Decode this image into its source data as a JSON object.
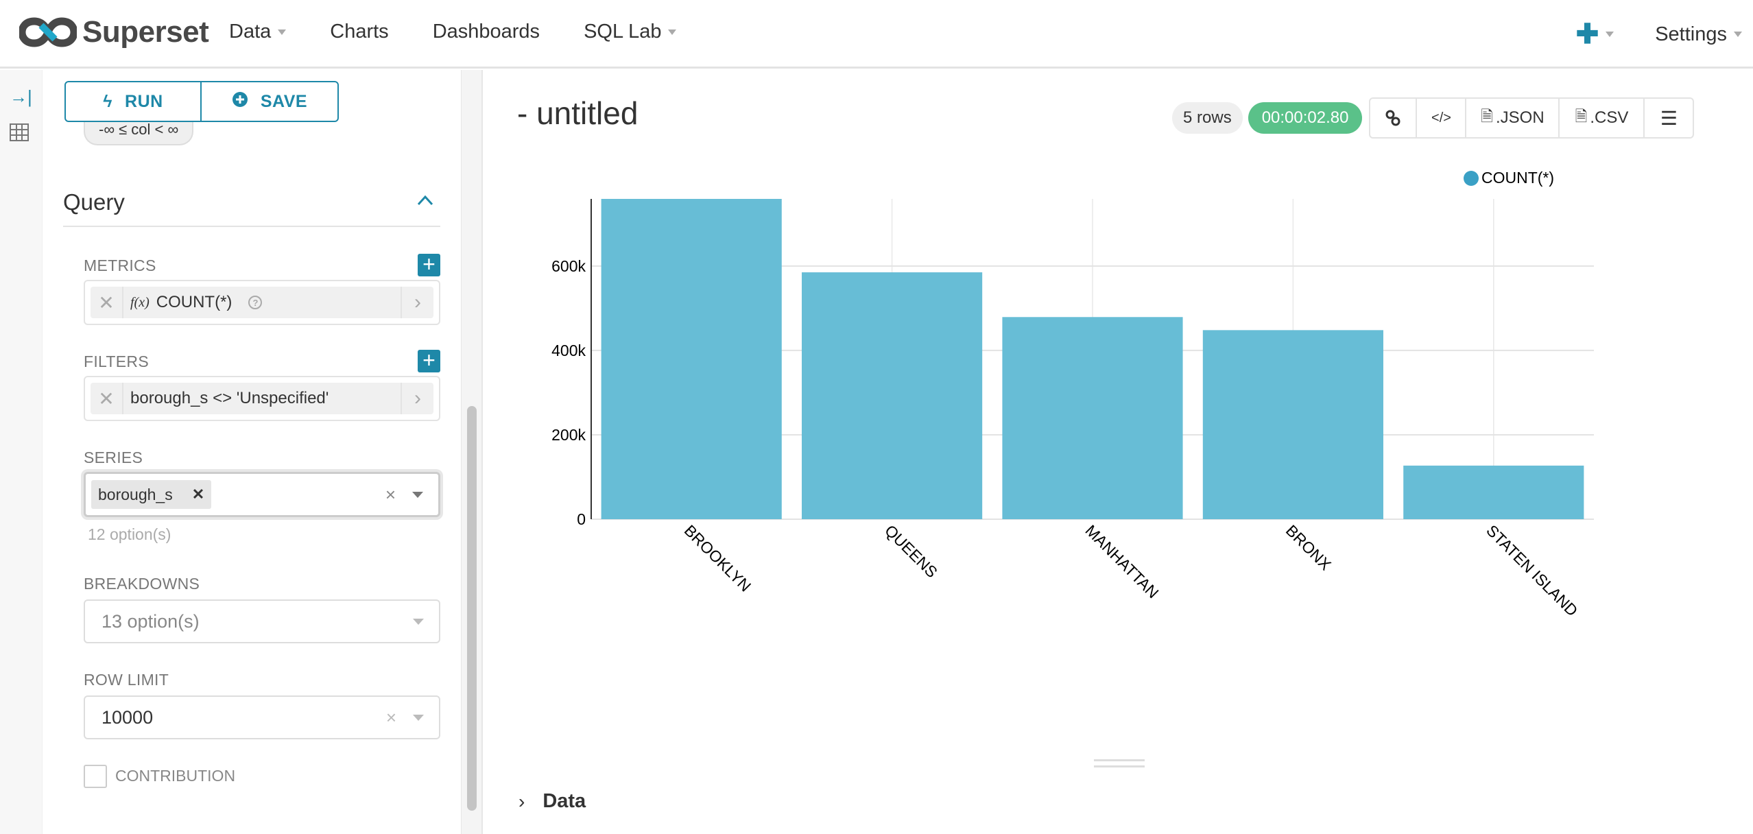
{
  "header": {
    "brand": "Superset",
    "nav": [
      {
        "label": "Data",
        "dropdown": true
      },
      {
        "label": "Charts",
        "dropdown": false
      },
      {
        "label": "Dashboards",
        "dropdown": false
      },
      {
        "label": "SQL Lab",
        "dropdown": true
      }
    ],
    "new_icon": "plus-icon",
    "settings_label": "Settings"
  },
  "sidebar_icons": [
    "collapse-arrow-icon",
    "table-grid-icon"
  ],
  "panel": {
    "run_label": "RUN",
    "save_label": "SAVE",
    "range_pill": "-∞ ≤ col < ∞",
    "section_title": "Query",
    "metrics": {
      "label": "METRICS",
      "value": "COUNT(*)",
      "fx": "f(x)"
    },
    "filters": {
      "label": "FILTERS",
      "value": "borough_s <> 'Unspecified'"
    },
    "series": {
      "label": "SERIES",
      "tag": "borough_s",
      "hint": "12 option(s)"
    },
    "breakdowns": {
      "label": "BREAKDOWNS",
      "placeholder": "13 option(s)"
    },
    "row_limit": {
      "label": "ROW LIMIT",
      "value": "10000"
    },
    "contribution": {
      "label": "CONTRIBUTION",
      "checked": false
    }
  },
  "main": {
    "title": "- untitled",
    "rows_badge": "5 rows",
    "time_badge": "00:00:02.80",
    "toolbar": {
      "link_icon": "link-icon",
      "embed_icon": "code-icon",
      "json_label": ".JSON",
      "csv_label": ".CSV",
      "menu_icon": "hamburger-icon"
    },
    "data_toggle": "Data"
  },
  "chart_data": {
    "type": "bar",
    "title": "",
    "xlabel": "",
    "ylabel": "",
    "categories": [
      "BROOKLYN",
      "QUEENS",
      "MANHATTAN",
      "BRONX",
      "STATEN ISLAND"
    ],
    "series": [
      {
        "name": "COUNT(*)",
        "values": [
          759000,
          585000,
          479000,
          448000,
          127000
        ],
        "color": "#67bdd6"
      }
    ],
    "legend": {
      "entries": [
        "COUNT(*)"
      ],
      "placement": "top-right",
      "color": "#3aa0c5"
    },
    "yticks": [
      0,
      200000,
      400000,
      600000
    ],
    "ytick_labels": [
      "0",
      "200k",
      "400k",
      "600k"
    ],
    "ylim": [
      0,
      759000
    ],
    "grid": true,
    "x_label_rotation_deg": 45
  }
}
